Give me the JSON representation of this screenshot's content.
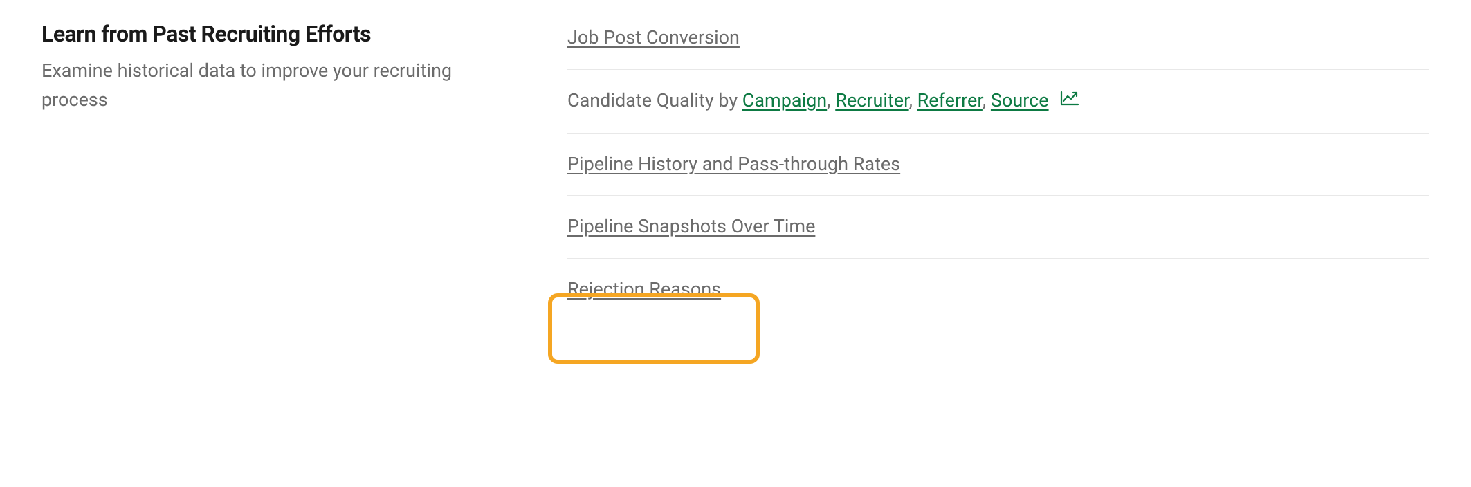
{
  "section": {
    "title": "Learn from Past Recruiting Efforts",
    "desc": "Examine historical data to improve your recruiting process"
  },
  "links": {
    "job_post_conversion": "Job Post Conversion",
    "candidate_quality_prefix": "Candidate Quality by ",
    "campaign": "Campaign",
    "recruiter": "Recruiter",
    "referrer": "Referrer",
    "source": "Source",
    "pipeline_history": "Pipeline History and Pass-through Rates",
    "pipeline_snapshots": "Pipeline Snapshots Over Time",
    "rejection_reasons": "Rejection Reasons"
  },
  "colors": {
    "accent_green": "#0d7a43",
    "text_gray": "#6b6b6b",
    "highlight_orange": "#f5a623"
  }
}
